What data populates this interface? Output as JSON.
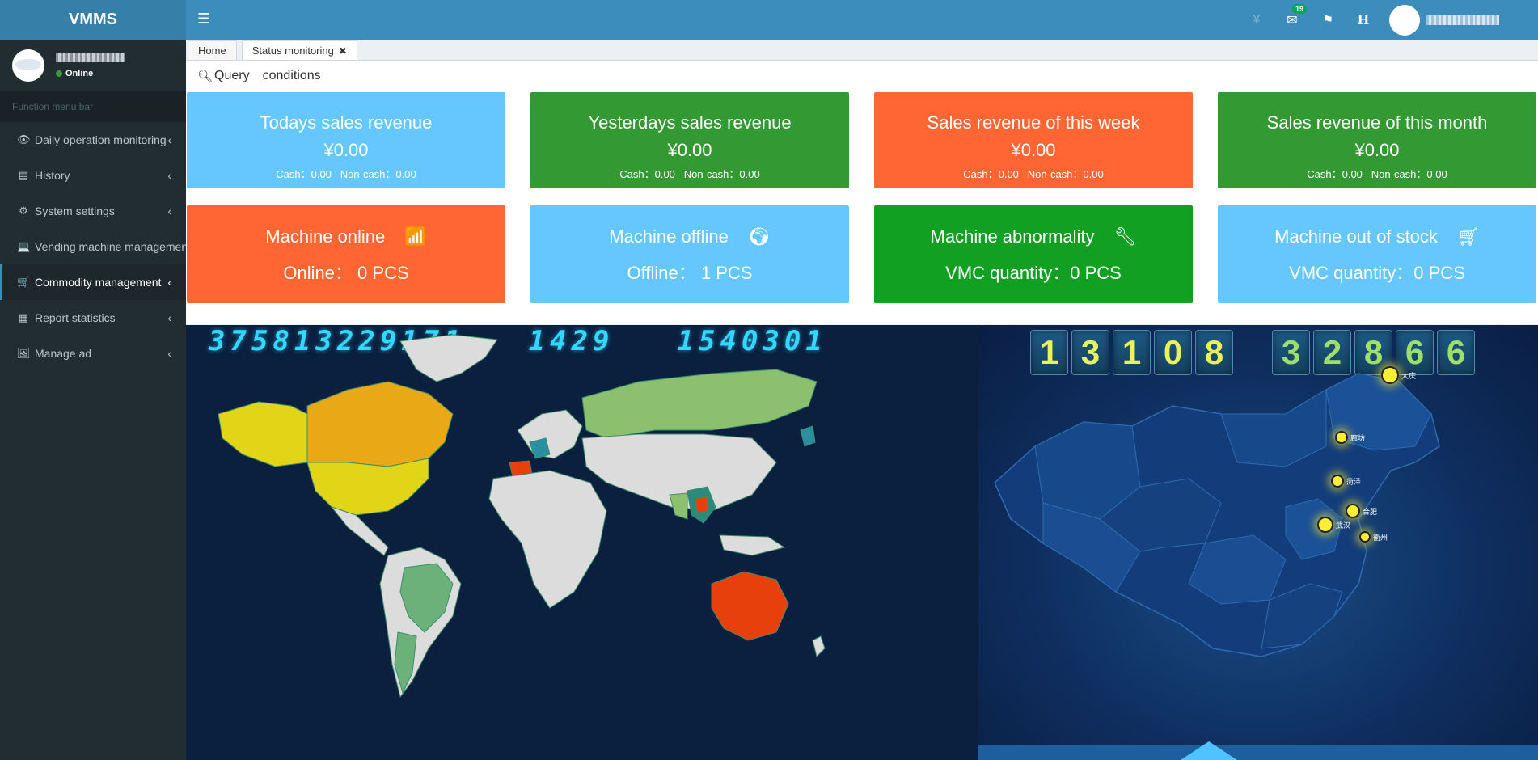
{
  "app": {
    "title": "VMMS"
  },
  "user": {
    "status": "Online"
  },
  "sidebar": {
    "header": "Function menu bar",
    "items": [
      {
        "label": "Daily operation monitoring",
        "icon": "eye-icon"
      },
      {
        "label": "History",
        "icon": "list-icon"
      },
      {
        "label": "System settings",
        "icon": "gear-icon"
      },
      {
        "label": "Vending machine management",
        "icon": "laptop-icon"
      },
      {
        "label": "Commodity management",
        "icon": "cart-icon",
        "active": true
      },
      {
        "label": "Report statistics",
        "icon": "table-icon"
      },
      {
        "label": "Manage ad",
        "icon": "image-icon"
      }
    ]
  },
  "header": {
    "notification_count": "19",
    "h_label": "H"
  },
  "tabs": [
    {
      "label": "Home"
    },
    {
      "label": "Status monitoring"
    }
  ],
  "query": {
    "label": "Query",
    "conditions": "conditions"
  },
  "sales_cards": [
    {
      "title": "Todays sales revenue",
      "amount": "¥0.00",
      "cash": "Cash：0.00",
      "noncash": "Non-cash：0.00",
      "color": "#66c7ff"
    },
    {
      "title": "Yesterdays sales revenue",
      "amount": "¥0.00",
      "cash": "Cash：0.00",
      "noncash": "Non-cash：0.00",
      "color": "#339933"
    },
    {
      "title": "Sales revenue of this week",
      "amount": "¥0.00",
      "cash": "Cash：0.00",
      "noncash": "Non-cash：0.00",
      "color": "#ff6633"
    },
    {
      "title": "Sales revenue of this month",
      "amount": "¥0.00",
      "cash": "Cash：0.00",
      "noncash": "Non-cash：0.00",
      "color": "#339933"
    }
  ],
  "machine_cards": [
    {
      "title": "Machine online",
      "count": "Online：  0  PCS",
      "icon": "signal-icon",
      "color": "#ff6633"
    },
    {
      "title": "Machine offline",
      "count": "Offline：  1  PCS",
      "icon": "globe-icon",
      "color": "#66c7ff"
    },
    {
      "title": "Machine abnormality",
      "count": "VMC quantity：0   PCS",
      "icon": "wrench-icon",
      "color": "#11a022"
    },
    {
      "title": "Machine out of stock",
      "count": "VMC quantity：0   PCS",
      "icon": "cart-icon",
      "color": "#66c7ff"
    }
  ],
  "world_ticker": [
    "375813229171",
    "1429",
    "1540301"
  ],
  "china_digits": [
    "1",
    "3",
    "1",
    "0",
    "8",
    "3",
    "2",
    "8",
    "6",
    "6"
  ],
  "china_cities": [
    {
      "name": "大庆"
    },
    {
      "name": "廊坊"
    },
    {
      "name": "菏泽"
    },
    {
      "name": "合肥"
    },
    {
      "name": "武汉"
    },
    {
      "name": "衢州"
    }
  ]
}
